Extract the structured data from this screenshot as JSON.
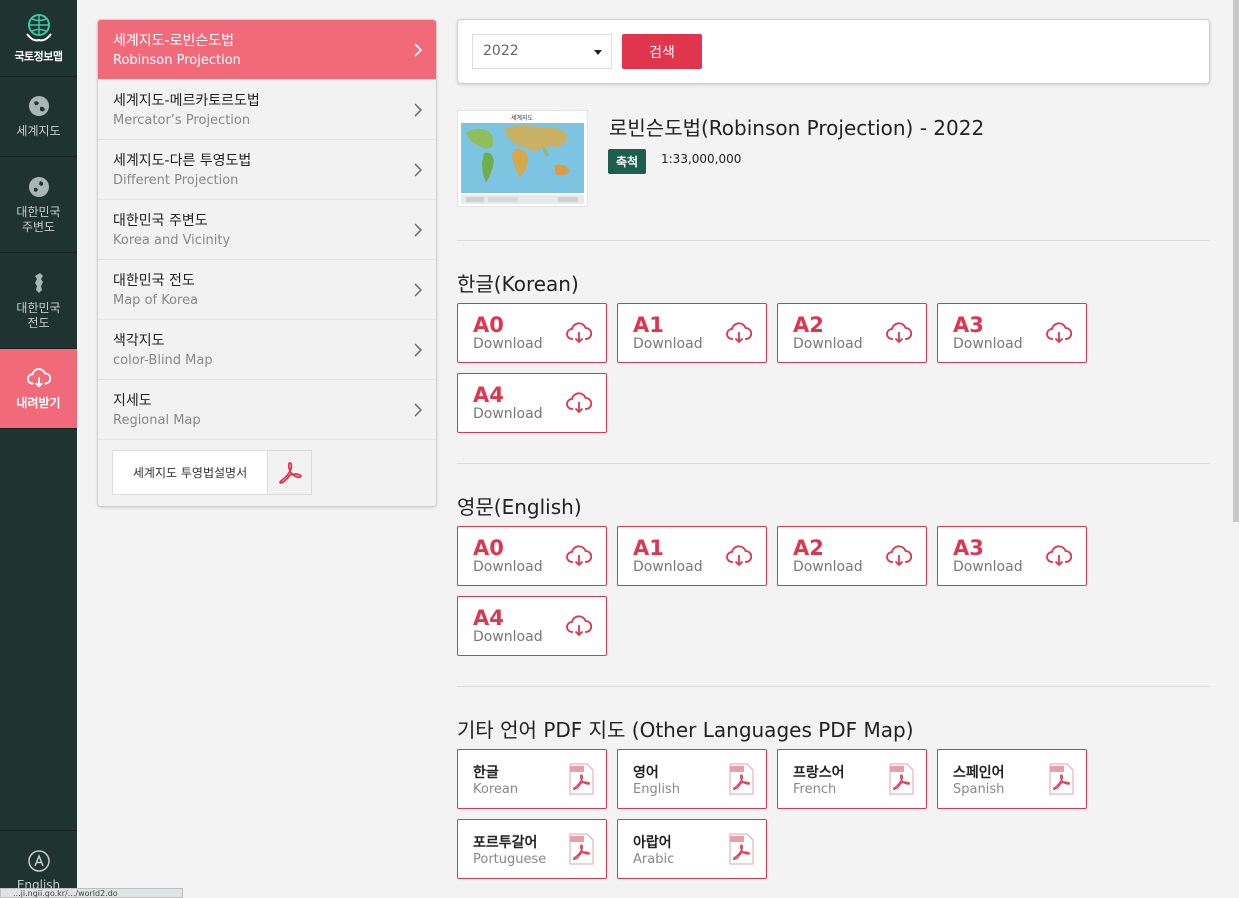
{
  "rail": {
    "logo_text": "국토정보맵",
    "items": [
      {
        "label": "세계지도"
      },
      {
        "label": "대한민국\n주변도"
      },
      {
        "label": "대한민국\n전도"
      },
      {
        "label": "내려받기"
      }
    ],
    "bottom_label": "English"
  },
  "menu": {
    "items": [
      {
        "ko": "세계지도-로빈슨도법",
        "en": "Robinson Projection"
      },
      {
        "ko": "세계지도-메르카토르도법",
        "en": "Mercator’s Projection"
      },
      {
        "ko": "세계지도-다른 투영도법",
        "en": "Different Projection"
      },
      {
        "ko": "대한민국 주변도",
        "en": "Korea and Vicinity"
      },
      {
        "ko": "대한민국 전도",
        "en": "Map of Korea"
      },
      {
        "ko": "색각지도",
        "en": "color-Blind Map"
      },
      {
        "ko": "지세도",
        "en": "Regional Map"
      }
    ],
    "guide_label": "세계지도 투영법설명서"
  },
  "search": {
    "year": "2022",
    "button": "검색"
  },
  "map": {
    "title": "로빈슨도법(Robinson Projection) - 2022",
    "scale_label": "축척",
    "scale_value": "1:33,000,000",
    "thumb_caption": "세계지도"
  },
  "korean": {
    "title": "한글(Korean)",
    "buttons": [
      {
        "size": "A0",
        "word": "Download"
      },
      {
        "size": "A1",
        "word": "Download"
      },
      {
        "size": "A2",
        "word": "Download"
      },
      {
        "size": "A3",
        "word": "Download"
      },
      {
        "size": "A4",
        "word": "Download"
      }
    ]
  },
  "english": {
    "title": "영문(English)",
    "buttons": [
      {
        "size": "A0",
        "word": "Download"
      },
      {
        "size": "A1",
        "word": "Download"
      },
      {
        "size": "A2",
        "word": "Download"
      },
      {
        "size": "A3",
        "word": "Download"
      },
      {
        "size": "A4",
        "word": "Download"
      }
    ]
  },
  "others": {
    "title": "기타 언어 PDF 지도 (Other Languages PDF Map)",
    "languages": [
      {
        "ko": "한글",
        "en": "Korean"
      },
      {
        "ko": "영어",
        "en": "English"
      },
      {
        "ko": "프랑스어",
        "en": "French"
      },
      {
        "ko": "스페인어",
        "en": "Spanish"
      },
      {
        "ko": "포르투갈어",
        "en": "Portuguese"
      },
      {
        "ko": "아랍어",
        "en": "Arabic"
      }
    ]
  },
  "status_url": "...ji.ngii.go.kr/.../world2.do",
  "colors": {
    "accent": "#e1354e",
    "rail": "#1f3330",
    "active": "#f06a7a",
    "badge": "#1d5e4c"
  }
}
